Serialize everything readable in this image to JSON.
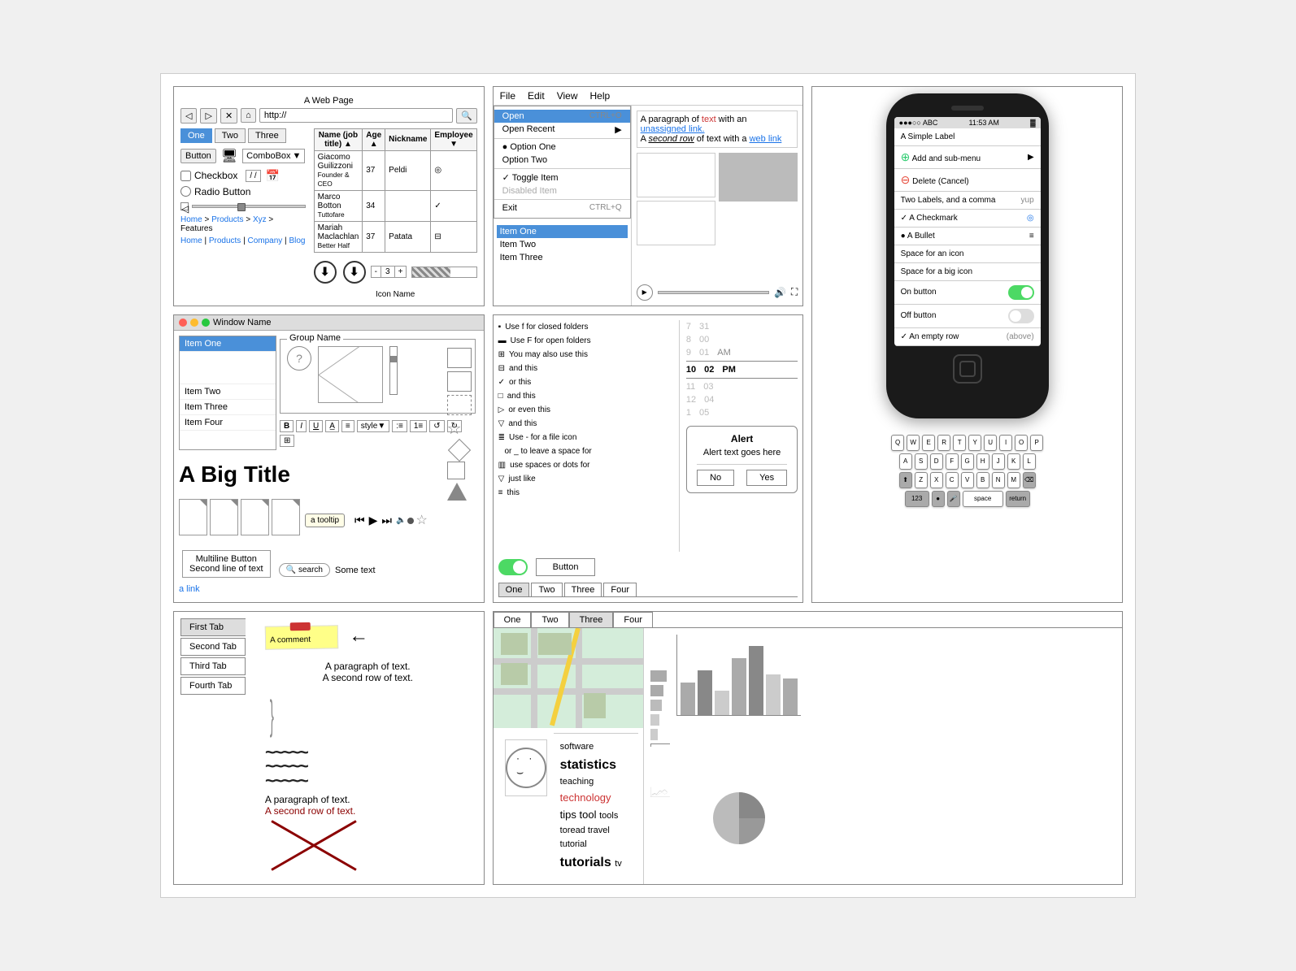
{
  "browser": {
    "title": "A Web Page",
    "url": "http://",
    "tabs": [
      "One",
      "Two",
      "Three"
    ],
    "active_tab": 0,
    "button_label": "Button",
    "combobox_label": "ComboBox",
    "checkbox_label": "Checkbox",
    "radio_label": "Radio Button",
    "date_value": "/ /",
    "table": {
      "headers": [
        "Name (job title)",
        "Age ▲",
        "Nickname",
        "Employee ▼"
      ],
      "rows": [
        [
          "Giacomo Guilizzoni\nFounder & CEO",
          "37",
          "Peldi",
          "◎"
        ],
        [
          "Marco Botton\nTuttofare",
          "34",
          "",
          "✓"
        ],
        [
          "Mariah Maclachlan\nBetter Half",
          "37",
          "Patata",
          "⊟"
        ]
      ]
    },
    "scroll_icons": [
      "⬇",
      "⬇"
    ],
    "icon_name": "Icon Name",
    "stepper_val": "3",
    "breadcrumb": [
      "Home",
      "Products",
      "Xyz",
      "Features"
    ],
    "pipe_links": [
      "Home",
      "Products",
      "Company",
      "Blog"
    ]
  },
  "menu_panel": {
    "menu_items": [
      "File",
      "Edit",
      "View",
      "Help"
    ],
    "file_menu": [
      {
        "label": "Open",
        "shortcut": "CTRL+O",
        "selected": true
      },
      {
        "label": "Open Recent",
        "arrow": "▶"
      },
      {
        "separator": true
      },
      {
        "label": "• Option One"
      },
      {
        "label": "Option Two"
      },
      {
        "separator": true
      },
      {
        "label": "✓ Toggle Item"
      },
      {
        "label": "Disabled Item",
        "disabled": true
      },
      {
        "separator": true
      },
      {
        "label": "Exit",
        "shortcut": "CTRL+Q"
      }
    ],
    "list_items": [
      "Item One",
      "Item Two",
      "Item Three"
    ],
    "text1": "A paragraph of ",
    "text1_red": "text",
    "text1_suffix": " with an ",
    "link1": "unassigned link.",
    "text2": "A ",
    "text2_italic": "second row",
    "text2_suffix": " of text with a web link"
  },
  "iphone": {
    "carrier": "●●●○○ ABC",
    "time": "11:53 AM",
    "battery": "▓",
    "menu_items": [
      {
        "label": "A Simple Label"
      },
      {
        "label": "Add and sub-menu",
        "icon": "green",
        "arrow": "▶"
      },
      {
        "label": "Delete (Cancel)",
        "icon": "red"
      },
      {
        "label": "Two Labels, and a comma",
        "right": "yup"
      },
      {
        "label": "✓ A Checkmark",
        "right": "◎"
      },
      {
        "label": "● A Bullet",
        "right": "≡"
      },
      {
        "label": "Space for an icon"
      },
      {
        "label": "Space for a big icon"
      },
      {
        "label": "On button",
        "toggle": "on"
      },
      {
        "label": "Off button",
        "toggle": "off"
      },
      {
        "label": "✓ An empty row",
        "right": "(above)"
      }
    ],
    "keyboard_rows": [
      [
        "Q",
        "W",
        "E",
        "R",
        "T",
        "Y",
        "U",
        "I",
        "O",
        "P"
      ],
      [
        "A",
        "S",
        "D",
        "F",
        "G",
        "H",
        "J",
        "K",
        "L"
      ],
      [
        "⬆",
        "Z",
        "X",
        "C",
        "V",
        "B",
        "N",
        "M",
        "⌫"
      ],
      [
        "123",
        "●",
        "🎤",
        "space",
        "return"
      ]
    ]
  },
  "list_panel": {
    "window_title": "Window Name",
    "group_name": "Group Name",
    "list_items": [
      "Item One",
      "Item Two",
      "Item Three",
      "Item Four"
    ],
    "big_title": "A Big Title",
    "tooltip": "a tooltip",
    "toolbar_items": [
      "B",
      "I",
      "U",
      "A̲",
      "≡",
      "style▼",
      ":≡",
      "1≡",
      "↺",
      "↻",
      "⊞"
    ],
    "media_controls": [
      "◀◀",
      "▶",
      "▶▶"
    ],
    "multiline_btn": [
      "Multiline Button",
      "Second line of text"
    ],
    "link_text": "a link",
    "search_placeholder": "search",
    "some_text": "Some text"
  },
  "icons_panel": {
    "icon_entries": [
      {
        "icon": "▪",
        "text": "Use f for closed folders"
      },
      {
        "icon": "▬",
        "text": "Use F for open folders"
      },
      {
        "icon": "+",
        "text": "You may also use this"
      },
      {
        "icon": "⊟",
        "text": "and this"
      },
      {
        "icon": "✓",
        "text": "or this"
      },
      {
        "icon": "□",
        "text": "and this"
      },
      {
        "icon": "▷",
        "text": "or even this"
      },
      {
        "icon": "▽",
        "text": "and this"
      },
      {
        "icon": "≣",
        "text": "Use - for a file icon"
      },
      {
        "icon": " ",
        "text": "or _ to leave a space for"
      },
      {
        "icon": "▥",
        "text": "use spaces or dots for"
      },
      {
        "icon": "▽",
        "text": "just like"
      },
      {
        "icon": "≡",
        "text": "this"
      }
    ],
    "numbers": {
      "col1": [
        "7",
        "8",
        "9",
        "10",
        "11",
        "12",
        "1"
      ],
      "col2": [
        "31",
        "00",
        "01",
        "02",
        "03",
        "04",
        "05"
      ],
      "col3": [
        "",
        "",
        "AM",
        "PM",
        "",
        "",
        ""
      ]
    },
    "alert": {
      "title": "Alert",
      "text": "Alert text goes here",
      "buttons": [
        "No",
        "Yes"
      ]
    },
    "toggle_on": true,
    "button_label": "Button",
    "tabs": [
      "One",
      "Two",
      "Three",
      "Four"
    ]
  },
  "wireframe_panel": {
    "tabs": [
      "First Tab",
      "Second Tab",
      "Third Tab",
      "Fourth Tab"
    ],
    "active_tab": 0,
    "comment_text": "A comment",
    "arrow_text": "",
    "para1": [
      "A paragraph of text.",
      "A second row of text."
    ],
    "para2": [
      "A paragraph of text.",
      "A second row of text."
    ]
  },
  "data_panel": {
    "tabs": [
      "One",
      "Two",
      "Three",
      "Four"
    ],
    "active_tab": 2,
    "word_cloud": {
      "words": [
        {
          "text": "software",
          "size": "small"
        },
        {
          "text": "statistics",
          "size": "big"
        },
        {
          "text": "teaching",
          "size": "small"
        },
        {
          "text": "technology",
          "size": "medium",
          "color": "red"
        },
        {
          "text": "tips",
          "size": "medium"
        },
        {
          "text": "tool",
          "size": "medium"
        },
        {
          "text": "tools",
          "size": "small"
        },
        {
          "text": "toread",
          "size": "small"
        },
        {
          "text": "travel",
          "size": "small"
        },
        {
          "text": "tutorial",
          "size": "small"
        },
        {
          "text": "tutorials",
          "size": "big"
        },
        {
          "text": "tv",
          "size": "small"
        }
      ]
    },
    "bar_chart_h": [
      80,
      65,
      55,
      45,
      35
    ],
    "bar_chart_v": [
      40,
      55,
      30,
      70,
      80,
      50,
      45
    ],
    "pie_segments": [
      70,
      30
    ]
  }
}
